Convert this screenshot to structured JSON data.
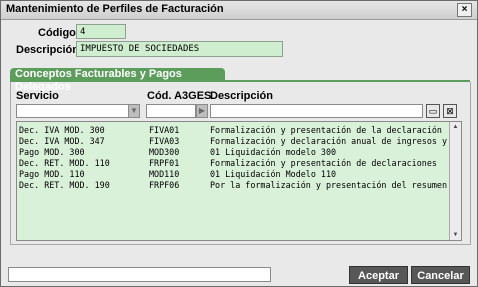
{
  "window": {
    "title": "Mantenimiento de Perfiles de Facturación",
    "close_glyph": "×"
  },
  "form": {
    "codigo_label": "Código",
    "codigo_value": "4",
    "descripcion_label": "Descripción",
    "descripcion_value": "IMPUESTO DE SOCIEDADES"
  },
  "section": {
    "title": "Conceptos Facturables y Pagos Delegados"
  },
  "table": {
    "headers": [
      "Servicio",
      "Cód. A3GES",
      "Descripción"
    ],
    "rows": [
      [
        "Dec. IVA MOD. 300",
        "FIVA01",
        "Formalización y presentación de la declaración"
      ],
      [
        "Dec. IVA MOD. 347",
        "FIVA03",
        "Formalización y declaración anual de ingresos y"
      ],
      [
        "Pago MOD. 300",
        "MOD300",
        "01 Liquidación modelo 300"
      ],
      [
        "Dec. RET. MOD. 110",
        "FRPF01",
        "Formalización y presentación de declaraciones"
      ],
      [
        "Pago MOD. 110",
        "MOD110",
        "01 Liquidación Modelo 110"
      ],
      [
        "Dec. RET. MOD. 190",
        "FRPF06",
        "Por la formalización y presentación del resumen"
      ]
    ]
  },
  "buttons": {
    "accept": "Aceptar",
    "cancel": "Cancelar"
  },
  "colors": {
    "accent_green": "#5c9d5c",
    "field_green": "#cfeecf",
    "list_green": "#d9f0d9"
  }
}
